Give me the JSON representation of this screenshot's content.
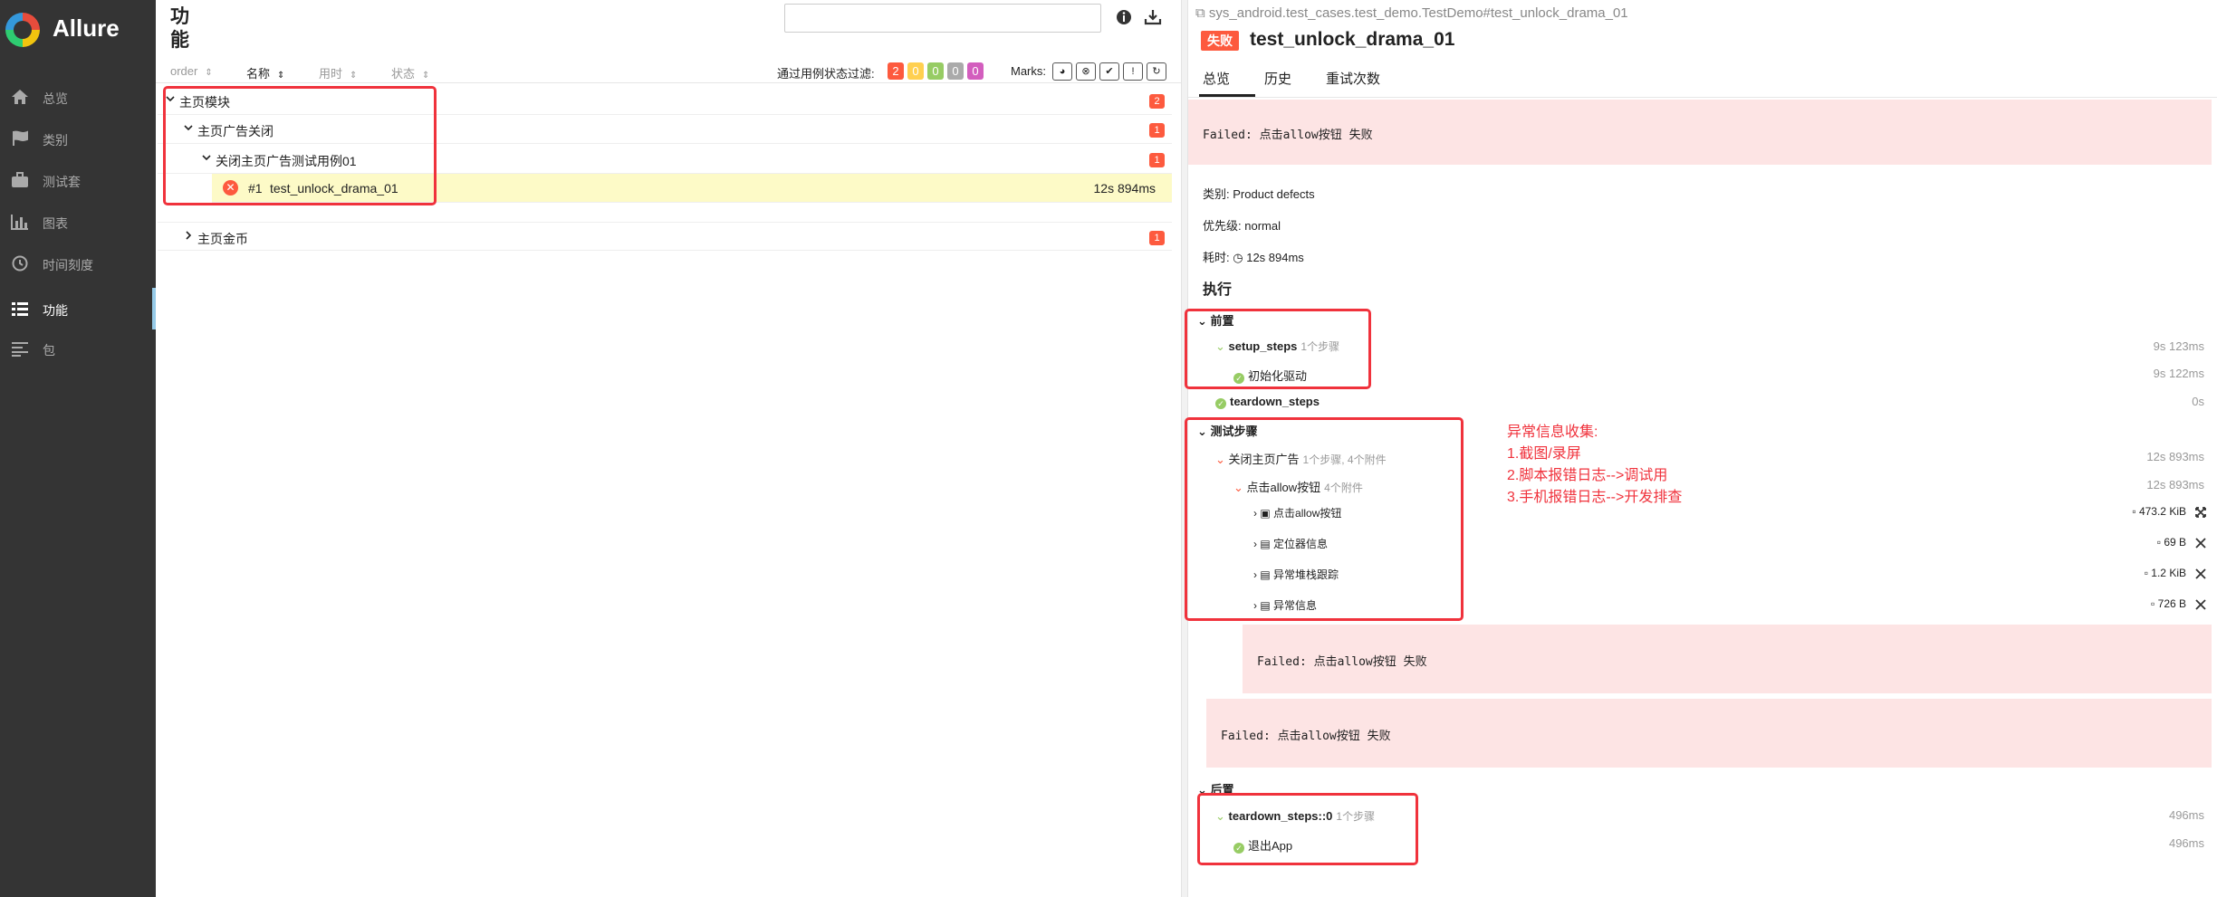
{
  "app": {
    "name": "Allure"
  },
  "sidebar": {
    "items": [
      {
        "label": "总览",
        "icon": "home-icon"
      },
      {
        "label": "类别",
        "icon": "flag-icon"
      },
      {
        "label": "测试套",
        "icon": "briefcase-icon"
      },
      {
        "label": "图表",
        "icon": "bar-chart-icon"
      },
      {
        "label": "时间刻度",
        "icon": "clock-icon"
      },
      {
        "label": "功能",
        "icon": "list-icon",
        "active": true
      },
      {
        "label": "包",
        "icon": "align-left-icon"
      }
    ]
  },
  "tree": {
    "title": "功能",
    "columns": {
      "order": "order",
      "name": "名称",
      "duration": "用时",
      "status": "状态"
    },
    "filter_label": "通过用例状态过滤:",
    "status_counts": [
      {
        "value": "2",
        "color": "#fd5a3e"
      },
      {
        "value": "0",
        "color": "#ffd050"
      },
      {
        "value": "0",
        "color": "#97cc64"
      },
      {
        "value": "0",
        "color": "#aaaaaa"
      },
      {
        "value": "0",
        "color": "#d35ebe"
      }
    ],
    "marks_label": "Marks:",
    "rows": [
      {
        "label": "主页模块",
        "badge": "2"
      },
      {
        "label": "主页广告关闭",
        "badge": "1"
      },
      {
        "label": "关闭主页广告测试用例01",
        "badge": "1"
      },
      {
        "order": "#1",
        "label": "test_unlock_drama_01",
        "duration": "12s 894ms"
      },
      {
        "label": "主页金币",
        "badge": "1"
      }
    ]
  },
  "detail": {
    "breadcrumb": "sys_android.test_cases.test_demo.TestDemo#test_unlock_drama_01",
    "status_label": "失败",
    "test_name": "test_unlock_drama_01",
    "tabs": [
      "总览",
      "历史",
      "重试次数"
    ],
    "error_message": "Failed:  点击allow按钮 失败",
    "category_label": "类别:",
    "category_value": "Product defects",
    "severity_label": "优先级:",
    "severity_value": "normal",
    "duration_label": "耗时:",
    "duration_value": "12s 894ms",
    "execution_title": "执行",
    "setup": {
      "title": "前置",
      "steps": [
        {
          "name": "setup_steps",
          "sub": "1个步骤",
          "duration": "9s 123ms"
        },
        {
          "name": "初始化驱动",
          "duration": "9s 122ms"
        },
        {
          "name": "teardown_steps",
          "duration": "0s"
        }
      ]
    },
    "test_body": {
      "title": "测试步骤",
      "steps": [
        {
          "name": "关闭主页广告",
          "sub": "1个步骤, 4个附件",
          "duration": "12s 893ms"
        },
        {
          "name": "点击allow按钮",
          "sub": "4个附件",
          "duration": "12s 893ms"
        }
      ],
      "attachments": [
        {
          "name": "点击allow按钮",
          "size": "473.2 KiB",
          "icon": "image-icon"
        },
        {
          "name": "定位器信息",
          "size": "69 B",
          "icon": "file-icon"
        },
        {
          "name": "异常堆栈跟踪",
          "size": "1.2 KiB",
          "icon": "file-icon"
        },
        {
          "name": "异常信息",
          "size": "726 B",
          "icon": "file-icon"
        }
      ],
      "step_error": "Failed:  点击allow按钮 失败",
      "test_error": "Failed:  点击allow按钮 失败"
    },
    "teardown": {
      "title": "后置",
      "steps": [
        {
          "name": "teardown_steps::0",
          "sub": "1个步骤",
          "duration": "496ms"
        },
        {
          "name": "退出App",
          "duration": "496ms"
        }
      ]
    }
  },
  "annotation": {
    "lines": [
      "异常信息收集:",
      "1.截图/录屏",
      "2.脚本报错日志-->调试用",
      "3.手机报错日志-->开发排查"
    ]
  },
  "colors": {
    "failed": "#fd5a3e",
    "passed": "#97cc64",
    "highlight": "#f0323c",
    "sidebar": "#343434"
  }
}
